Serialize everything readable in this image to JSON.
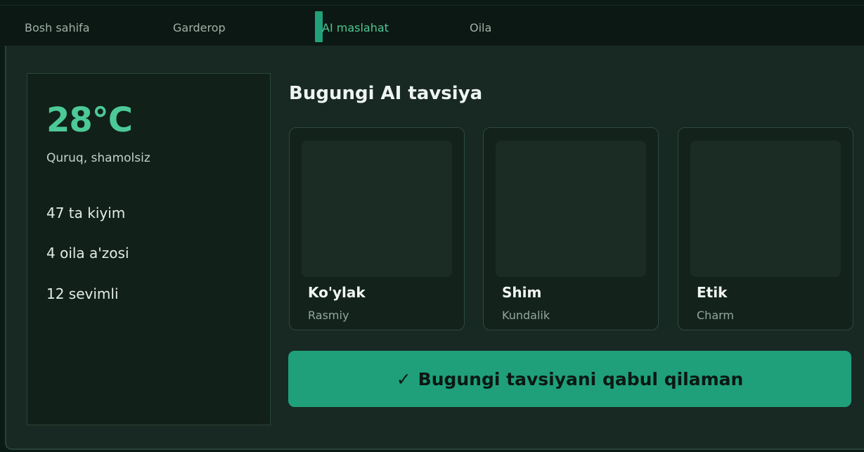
{
  "nav": {
    "items": [
      {
        "label": "Bosh sahifa",
        "active": false
      },
      {
        "label": "Garderop",
        "active": false
      },
      {
        "label": "AI maslahat",
        "active": true
      },
      {
        "label": "Oila",
        "active": false
      }
    ]
  },
  "weather": {
    "temperature": "28°C",
    "description": "Quruq, shamolsiz"
  },
  "stats": [
    "47 ta kiyim",
    "4 oila a'zosi",
    "12 sevimli"
  ],
  "recommendation": {
    "title": "Bugungi AI tavsiya",
    "items": [
      {
        "name": "Ko'ylak",
        "style": "Rasmiy"
      },
      {
        "name": "Shim",
        "style": "Kundalik"
      },
      {
        "name": "Etik",
        "style": "Charm"
      }
    ],
    "accept_icon": "✓",
    "accept_label": "Bugungi tavsiyani qabul qilaman"
  },
  "colors": {
    "accent": "#1fa07a",
    "accent_text": "#4cc997",
    "background": "#182823"
  }
}
